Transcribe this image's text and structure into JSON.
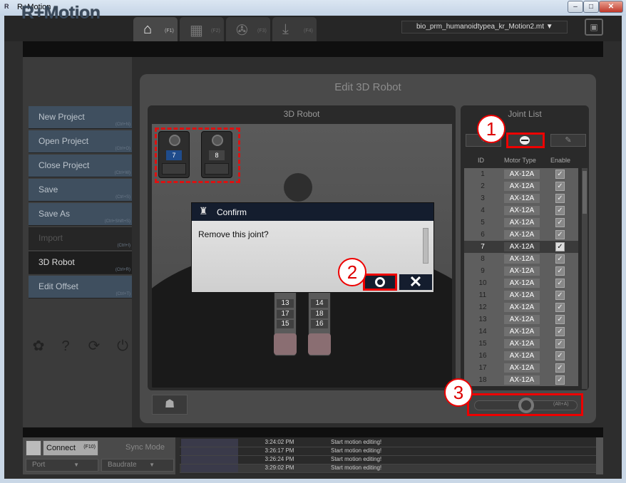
{
  "window": {
    "title": "R+Motion",
    "app_icon": "R",
    "controls": {
      "minimize": "–",
      "maximize": "□",
      "close": "✕"
    }
  },
  "header": {
    "logo": "R+Motion",
    "tabs": [
      {
        "icon": "home-icon",
        "glyph": "⌂",
        "hotkey": "(F1)"
      },
      {
        "icon": "film-icon",
        "glyph": "▦",
        "hotkey": "(F2)"
      },
      {
        "icon": "reel-icon",
        "glyph": "✇",
        "hotkey": "(F3)"
      },
      {
        "icon": "download-icon",
        "glyph": "⤓",
        "hotkey": "(F4)"
      }
    ],
    "file_select": "bio_prm_humanoidtypea_kr_Motion2.mt ▼",
    "save_icon": "▣"
  },
  "menu": {
    "items": [
      {
        "label": "New Project",
        "shortcut": "(Ctrl+N)"
      },
      {
        "label": "Open Project",
        "shortcut": "(Ctrl+O)"
      },
      {
        "label": "Close Project",
        "shortcut": "(Ctrl+W)"
      },
      {
        "label": "Save",
        "shortcut": "(Ctrl+S)"
      },
      {
        "label": "Save As",
        "shortcut": "(Ctrl+Shift+S)"
      },
      {
        "label": "Import",
        "shortcut": "(Ctrl+I)"
      },
      {
        "label": "3D Robot",
        "shortcut": "(Ctrl+R)"
      },
      {
        "label": "Edit Offset",
        "shortcut": "(Ctrl+T)"
      }
    ],
    "bottom_icons": [
      {
        "name": "gear-icon",
        "glyph": "✿"
      },
      {
        "name": "help-icon",
        "glyph": "?"
      },
      {
        "name": "refresh-icon",
        "glyph": "⟳"
      },
      {
        "name": "power-icon",
        "glyph": "⏻"
      }
    ]
  },
  "edit3d": {
    "title": "Edit 3D Robot",
    "robot_pane_title": "3D Robot",
    "servo_ids": [
      "7",
      "8"
    ],
    "leg_numbers": [
      "13",
      "14",
      "17",
      "18",
      "15",
      "16"
    ],
    "robot_button_icon": "robot-icon"
  },
  "joint_list": {
    "title": "Joint List",
    "headers": {
      "id": "ID",
      "motor_type": "Motor Type",
      "enable": "Enable"
    },
    "selected_id": "7",
    "rows": [
      {
        "id": "1",
        "motor": "AX-12A",
        "enabled": true
      },
      {
        "id": "2",
        "motor": "AX-12A",
        "enabled": true
      },
      {
        "id": "3",
        "motor": "AX-12A",
        "enabled": true
      },
      {
        "id": "4",
        "motor": "AX-12A",
        "enabled": true
      },
      {
        "id": "5",
        "motor": "AX-12A",
        "enabled": true
      },
      {
        "id": "6",
        "motor": "AX-12A",
        "enabled": true
      },
      {
        "id": "7",
        "motor": "AX-12A",
        "enabled": true
      },
      {
        "id": "8",
        "motor": "AX-12A",
        "enabled": true
      },
      {
        "id": "9",
        "motor": "AX-12A",
        "enabled": true
      },
      {
        "id": "10",
        "motor": "AX-12A",
        "enabled": true
      },
      {
        "id": "11",
        "motor": "AX-12A",
        "enabled": true
      },
      {
        "id": "12",
        "motor": "AX-12A",
        "enabled": true
      },
      {
        "id": "13",
        "motor": "AX-12A",
        "enabled": true
      },
      {
        "id": "14",
        "motor": "AX-12A",
        "enabled": true
      },
      {
        "id": "15",
        "motor": "AX-12A",
        "enabled": true
      },
      {
        "id": "16",
        "motor": "AX-12A",
        "enabled": true
      },
      {
        "id": "17",
        "motor": "AX-12A",
        "enabled": true
      },
      {
        "id": "18",
        "motor": "AX-12A",
        "enabled": true
      }
    ],
    "toggle_hint": "(Alt+A)"
  },
  "dialog": {
    "title": "Confirm",
    "message": "Remove this joint?",
    "cancel_glyph": "✕"
  },
  "markers": [
    "1",
    "2",
    "3"
  ],
  "bottom": {
    "connect": {
      "label": "Connect",
      "shortcut": "(F10)"
    },
    "sync_mode": "Sync Mode",
    "port": "Port",
    "baudrate": "Baudrate",
    "log": [
      {
        "time": "3:24:02 PM",
        "message": "Start motion editing!"
      },
      {
        "time": "3:26:17 PM",
        "message": "Start motion editing!"
      },
      {
        "time": "3:26:24 PM",
        "message": "Start motion editing!"
      },
      {
        "time": "3:29:02 PM",
        "message": "Start motion editing!"
      }
    ]
  },
  "colors": {
    "highlight_red": "#e00000",
    "dialog_title_bg": "#141d2e",
    "menu_bg": "#3f4f5f"
  }
}
